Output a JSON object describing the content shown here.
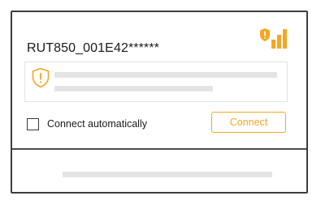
{
  "network": {
    "ssid": "RUT850_001E42******",
    "signal_icon": "secured-signal-strength-icon",
    "security_badge_icon": "shield-exclamation-icon",
    "warning_icon": "shield-exclamation-icon",
    "connect_automatically_label": "Connect automatically",
    "connect_automatically_checked": false,
    "connect_label": "Connect"
  },
  "colors": {
    "accent": "#f5a623",
    "border": "#3d3d3d",
    "placeholder": "#e4e4e4"
  }
}
